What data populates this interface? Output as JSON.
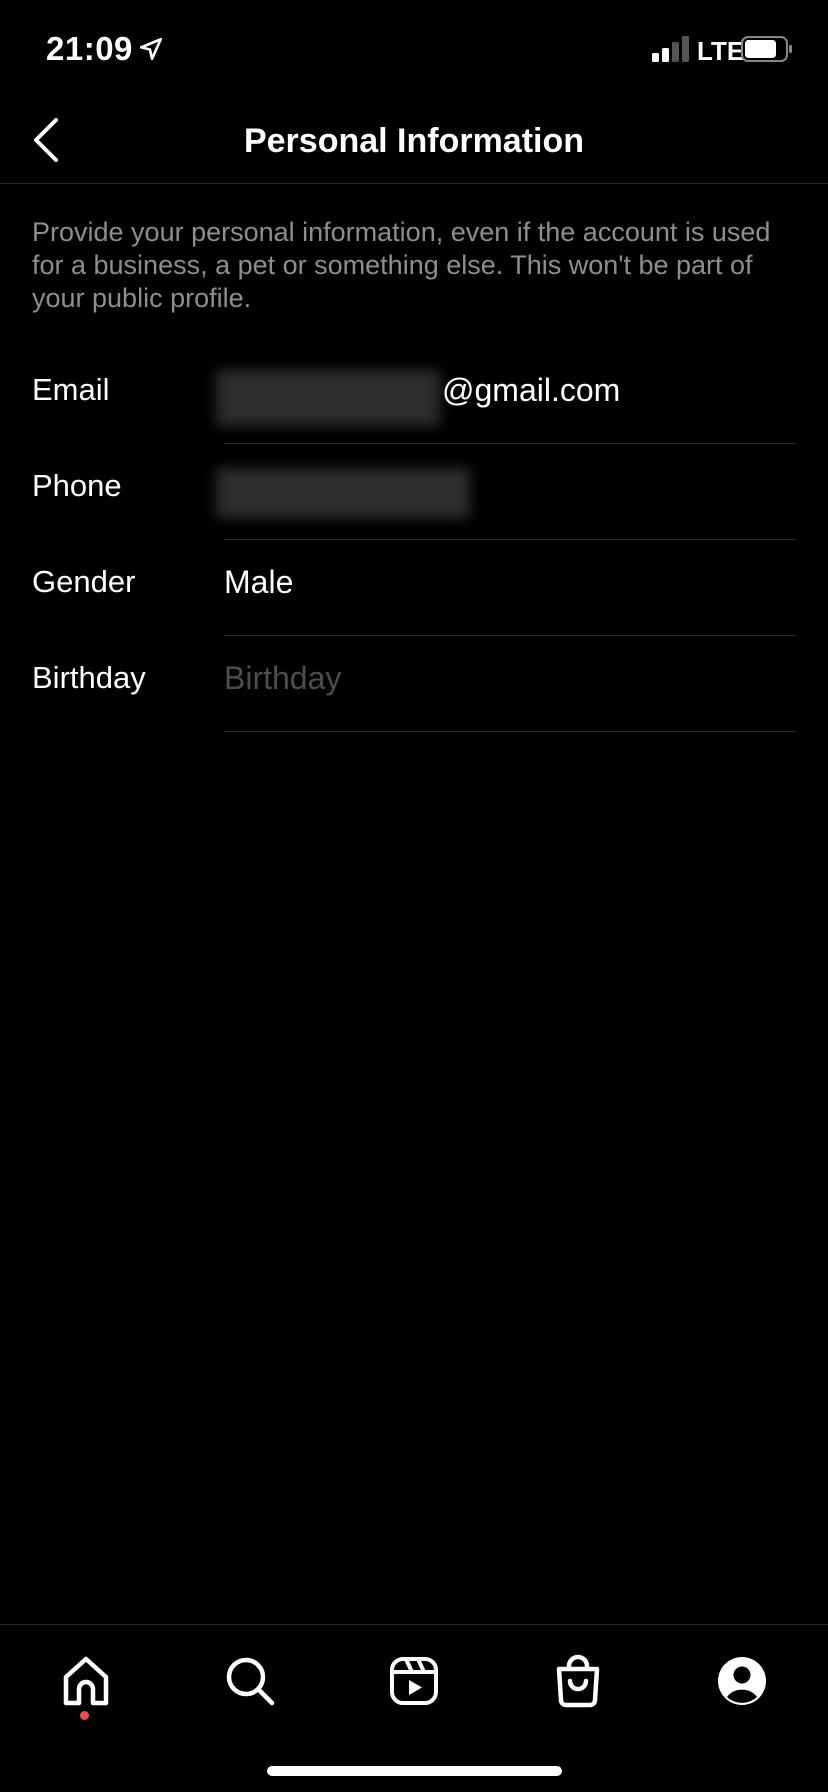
{
  "status_bar": {
    "time": "21:09",
    "network": "LTE",
    "icons": [
      "location-arrow-icon",
      "signal-icon",
      "battery-icon"
    ]
  },
  "header": {
    "title": "Personal Information",
    "back_icon": "chevron-left-icon"
  },
  "description": "Provide your personal information, even if the account is used for a business, a pet or something else. This won't be part of your public profile.",
  "form": {
    "email": {
      "label": "Email",
      "value_suffix": "@gmail.com"
    },
    "phone": {
      "label": "Phone"
    },
    "gender": {
      "label": "Gender",
      "value": "Male"
    },
    "birthday": {
      "label": "Birthday",
      "placeholder": "Birthday"
    }
  },
  "tab_bar": {
    "tabs": [
      "home-icon",
      "search-icon",
      "reels-icon",
      "shop-icon",
      "profile-icon"
    ],
    "active": "home-icon",
    "notification_color": "#ed4956"
  },
  "colors": {
    "background": "#000000",
    "text": "#ffffff",
    "secondary_text": "#8e8e8e",
    "placeholder": "#4d4d4d",
    "divider": "#262626"
  }
}
